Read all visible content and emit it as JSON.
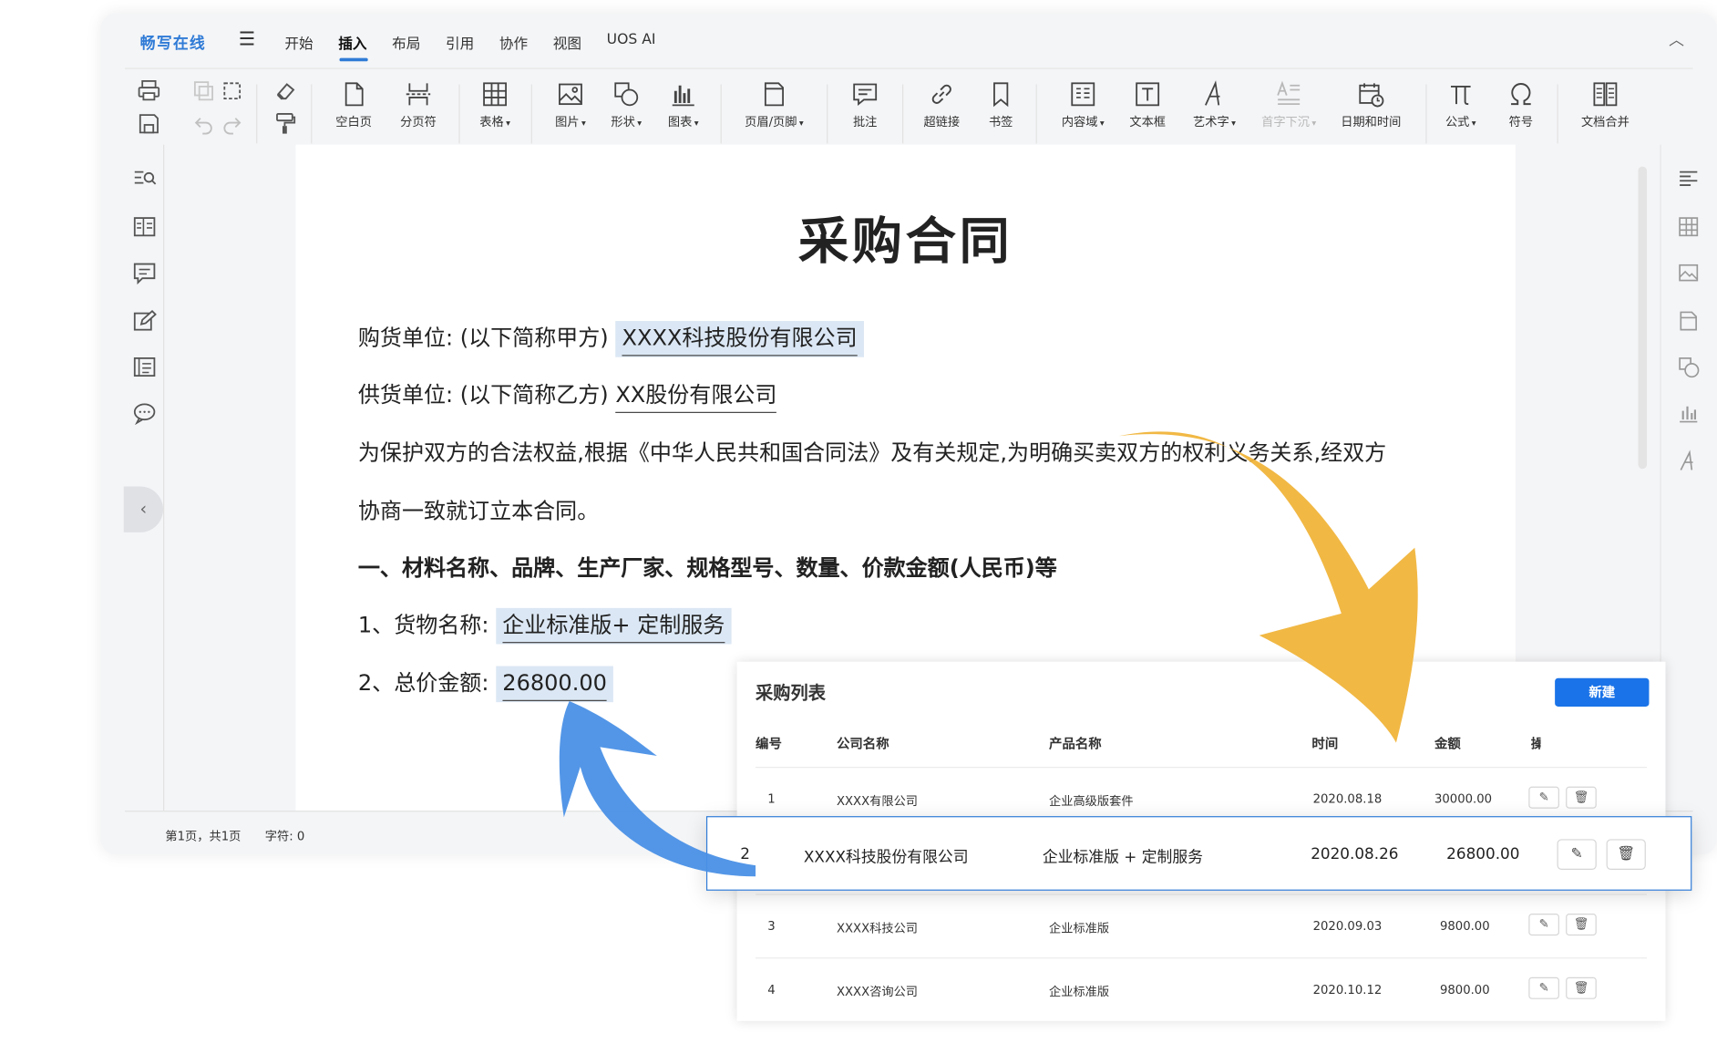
{
  "app": {
    "brand": "畅写在线",
    "menu": [
      "开始",
      "插入",
      "布局",
      "引用",
      "协作",
      "视图",
      "UOS AI"
    ],
    "active_menu": "插入"
  },
  "toolbar": {
    "blank_page": "空白页",
    "page_break": "分页符",
    "table": "表格",
    "image": "图片",
    "shape": "形状",
    "chart": "图表",
    "header_footer": "页眉/页脚",
    "comment": "批注",
    "hyperlink": "超链接",
    "bookmark": "书签",
    "content_field": "内容域",
    "textbox": "文本框",
    "wordart": "艺术字",
    "dropcap": "首字下沉",
    "datetime": "日期和时间",
    "formula": "公式",
    "symbol": "符号",
    "merge": "文档合并"
  },
  "document": {
    "title": "采购合同",
    "buyer_label": "购货单位: (以下简称甲方) ",
    "buyer_value": "XXXX科技股份有限公司",
    "supplier_label": "供货单位: (以下简称乙方) ",
    "supplier_value": "XX股份有限公司",
    "para1": "为保护双方的合法权益,根据《中华人民共和国合同法》及有关规定,为明确买卖双方的权利义务关系,经双方",
    "para2": "协商一致就订立本合同。",
    "section1": "一、材料名称、品牌、生产厂家、规格型号、数量、价款金额(人民币)等",
    "goods_label": "1、货物名称: ",
    "goods_value": "企业标准版+ 定制服务",
    "total_label": "2、总价金额: ",
    "total_value": "26800.00"
  },
  "status": {
    "page": "第1页，共1页",
    "chars": "字符: 0"
  },
  "purchase_list": {
    "title": "采购列表",
    "new_button": "新建",
    "headers": [
      "编号",
      "公司名称",
      "产品名称",
      "时间",
      "金额",
      "操"
    ],
    "rows": [
      {
        "id": "1",
        "company": "XXXX有限公司",
        "product": "企业高级版套件",
        "date": "2020.08.18",
        "amount": "30000.00"
      },
      {
        "id": "2",
        "company": "XXXX科技股份有限公司",
        "product": "企业标准版 + 定制服务",
        "date": "2020.08.26",
        "amount": "26800.00"
      },
      {
        "id": "3",
        "company": "XXXX科技公司",
        "product": "企业标准版",
        "date": "2020.09.03",
        "amount": "9800.00"
      },
      {
        "id": "4",
        "company": "XXXX咨询公司",
        "product": "企业标准版",
        "date": "2020.10.12",
        "amount": "9800.00"
      }
    ]
  },
  "colors": {
    "accent": "#2f7bd6",
    "highlight": "#dbe7f4",
    "arrow_yellow": "#f0b43a",
    "arrow_blue": "#4a90e6",
    "button": "#1a73e8"
  }
}
